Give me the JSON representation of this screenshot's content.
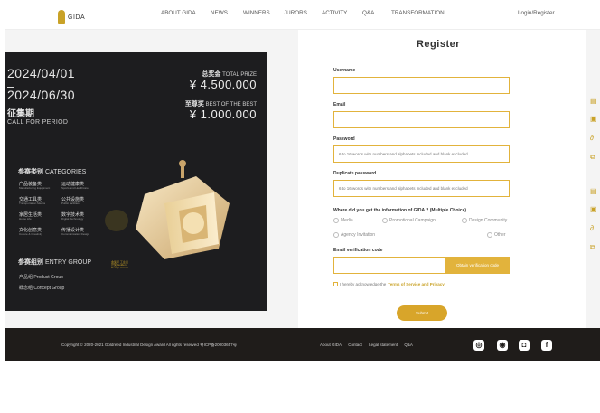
{
  "nav": {
    "logo_text": "GIDA",
    "items": [
      "ABOUT GIDA",
      "NEWS",
      "WINNERS",
      "JURORS",
      "ACTIVITY",
      "Q&A",
      "TRANSFORMATION"
    ],
    "login": "Login/Register"
  },
  "page": {
    "title": "Register"
  },
  "poster": {
    "date_start": "2024/04/01",
    "dash": "–",
    "date_end": "2024/06/30",
    "period_zh": "征集期",
    "period_en": "CALL FOR PERIOD",
    "total_prize_zh": "总奖金",
    "total_prize_en": "TOTAL PRIZE",
    "total_prize_value": "¥ 4.500.000",
    "best_zh": "至尊奖",
    "best_en": "BEST OF THE BEST",
    "best_value": "¥ 1.000.000",
    "categories_zh": "参赛类别",
    "categories_en": "CATEGORIES",
    "categories": [
      {
        "zh": "产品装备类",
        "en": "Manufacturing Equipment"
      },
      {
        "zh": "运动健康类",
        "en": "Sports and Healthcare"
      },
      {
        "zh": "交通工具类",
        "en": "Transportation Means"
      },
      {
        "zh": "公共设施类",
        "en": "Public facilities"
      },
      {
        "zh": "家居生活类",
        "en": "Home Life"
      },
      {
        "zh": "数字技术类",
        "en": "Digital Technology"
      },
      {
        "zh": "文化创意类",
        "en": "Culture & Creativity"
      },
      {
        "zh": "传播设计类",
        "en": "Communication Design"
      }
    ],
    "group_zh": "参赛组别",
    "group_en": "ENTRY GROUP",
    "groups": [
      "产品组 Product Group",
      "概念组 Concept Group"
    ],
    "badge_text": "金奖杯 工业设计奖 Golden Design Award"
  },
  "form": {
    "username_label": "Username",
    "email_label": "Email",
    "password_label": "Password",
    "password_placeholder": "6 to 16 words with numbers and alphabets included and blank excluded",
    "dup_password_label": "Duplicate password",
    "dup_password_placeholder": "6 to 16 words with numbers and alphabets included and blank excluded",
    "source_label": "Where did you get the information of GIDA ? (Multiple Choice)",
    "options": [
      "Media",
      "Promotional Campaign",
      "Design Community",
      "Agency Invitation",
      "Other"
    ],
    "code_label": "Email verification code",
    "code_button": "Obtain verification code",
    "agree_text": "I hereby acknowledge the",
    "agree_link": "Terms of Service and Privacy",
    "submit": "Submit"
  },
  "footer": {
    "copyright": "Copyright © 2020-2021 Goldreed Industrial Design Award All rights reserved  粤ICP备20003657号",
    "links": [
      "About GIDA",
      "Contact",
      "Legal statement",
      "Q&A"
    ]
  },
  "icons": {
    "social": [
      "wechat-icon",
      "weibo-icon",
      "instagram-icon",
      "facebook-icon"
    ],
    "side": [
      "edit-icon",
      "image-icon",
      "link-icon",
      "share-icon"
    ]
  },
  "colors": {
    "accent": "#e2b33c",
    "button": "#d8a52a",
    "footer": "#1f1c1a",
    "poster": "#1d1d1f"
  }
}
